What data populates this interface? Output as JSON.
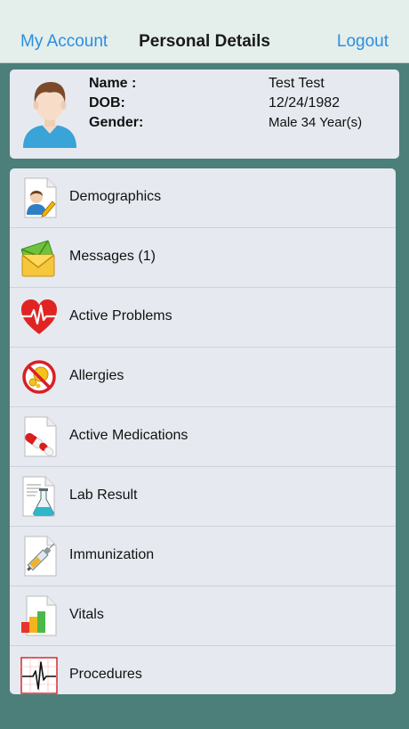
{
  "navbar": {
    "left_label": "My Account",
    "title": "Personal Details",
    "right_label": "Logout"
  },
  "profile": {
    "name_label": "Name :",
    "name_value": "Test Test",
    "dob_label": "DOB:",
    "dob_value": "12/24/1982",
    "gender_label": "Gender:",
    "gender_value": "Male 34 Year(s)"
  },
  "menu": {
    "items": [
      {
        "label": "Demographics",
        "icon": "demographics-icon"
      },
      {
        "label": "Messages (1)",
        "icon": "envelope-icon"
      },
      {
        "label": "Active Problems",
        "icon": "heart-pulse-icon"
      },
      {
        "label": "Allergies",
        "icon": "no-allergy-icon"
      },
      {
        "label": "Active Medications",
        "icon": "pills-icon"
      },
      {
        "label": "Lab Result",
        "icon": "flask-icon"
      },
      {
        "label": "Immunization",
        "icon": "syringe-icon"
      },
      {
        "label": "Vitals",
        "icon": "bar-chart-icon"
      },
      {
        "label": "Procedures",
        "icon": "ecg-icon"
      }
    ]
  },
  "colors": {
    "background": "#4d7f7a",
    "navbar": "#e4eeeb",
    "accent": "#2b8ee0",
    "card": "#e6eaf0"
  }
}
